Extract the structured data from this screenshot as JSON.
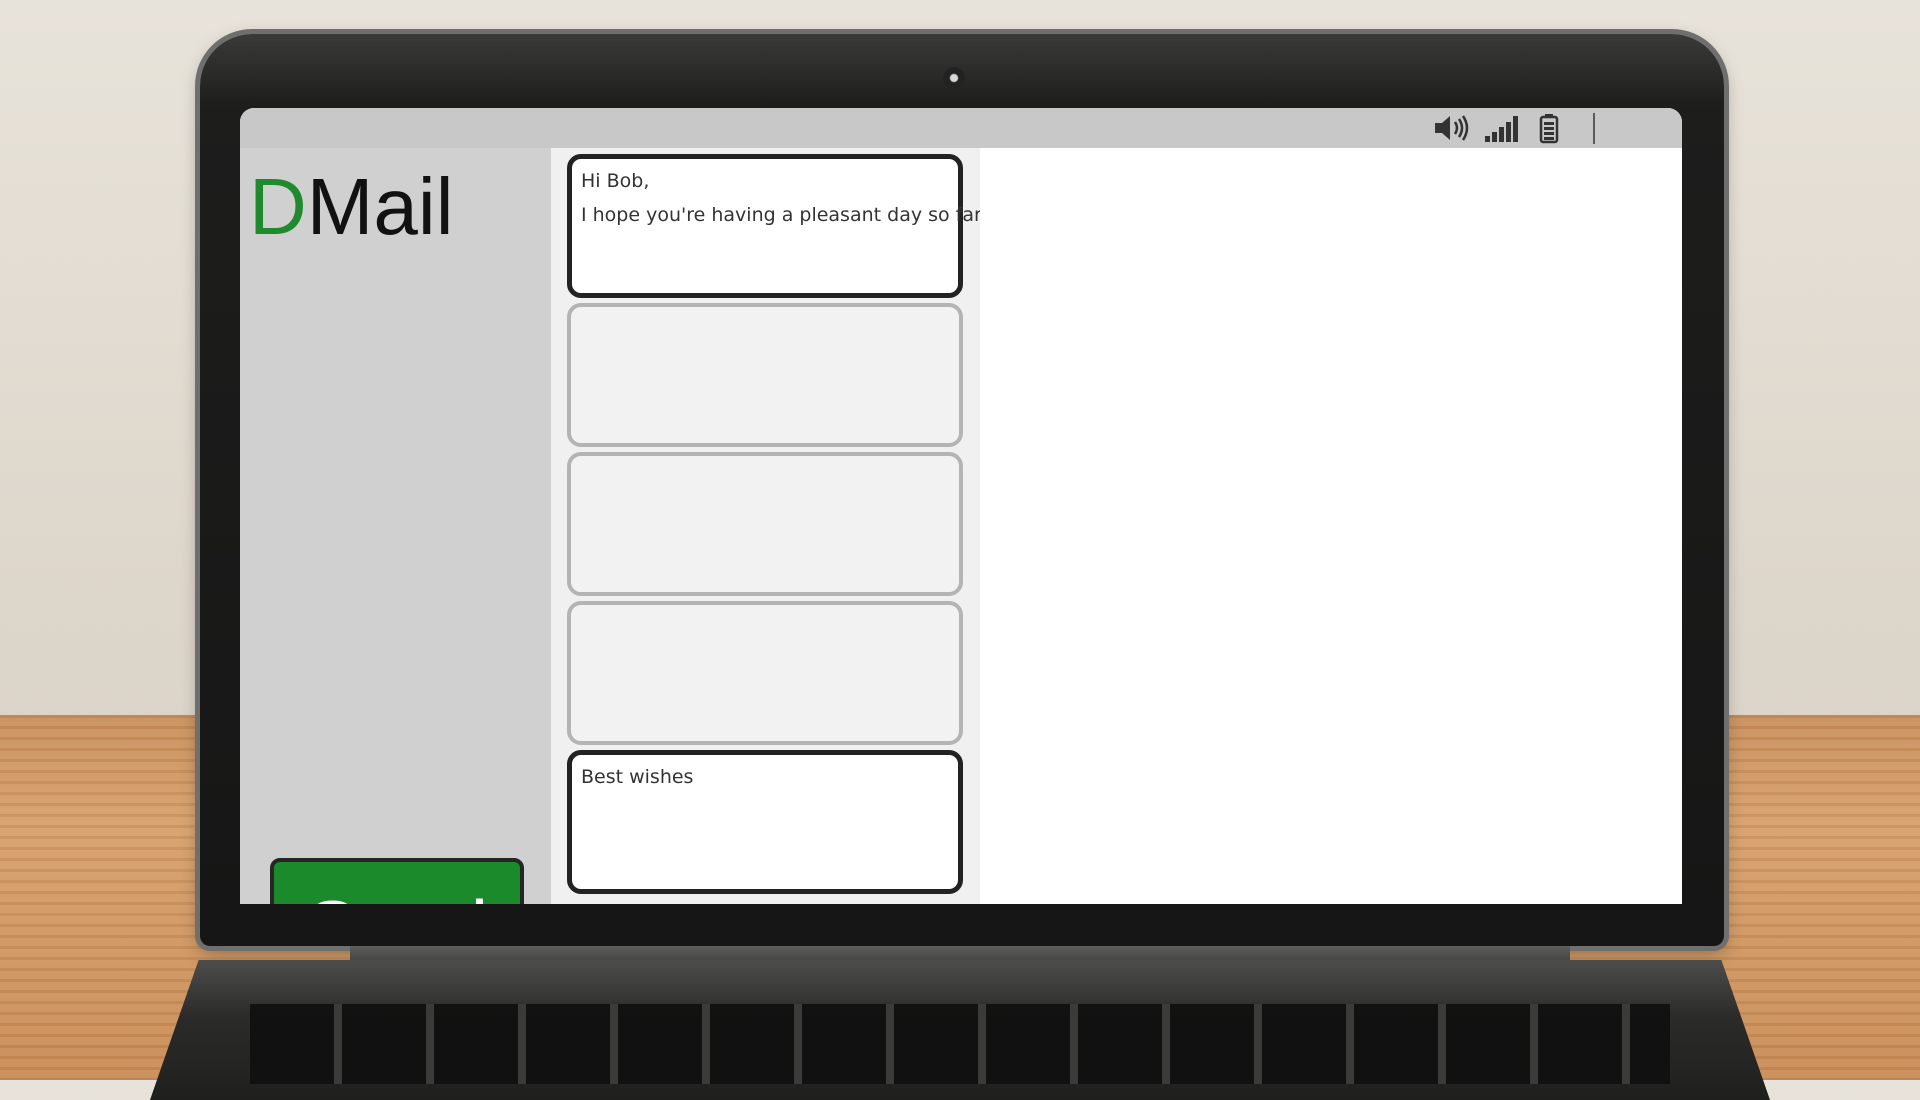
{
  "app": {
    "logo_first_letter": "D",
    "logo_rest": "Mail",
    "accent_color": "#1f8a2e"
  },
  "statusbar": {
    "icons": [
      "speaker-icon",
      "signal-icon",
      "battery-icon"
    ]
  },
  "sidebar": {
    "send_label": "Send"
  },
  "email_blocks": [
    {
      "lines": [
        "Hi Bob,",
        "I hope you're having a pleasant day so far."
      ],
      "state": "active"
    },
    {
      "lines": [],
      "state": "empty"
    },
    {
      "lines": [],
      "state": "empty"
    },
    {
      "lines": [],
      "state": "empty"
    },
    {
      "lines": [
        "Best wishes"
      ],
      "state": "active"
    }
  ]
}
